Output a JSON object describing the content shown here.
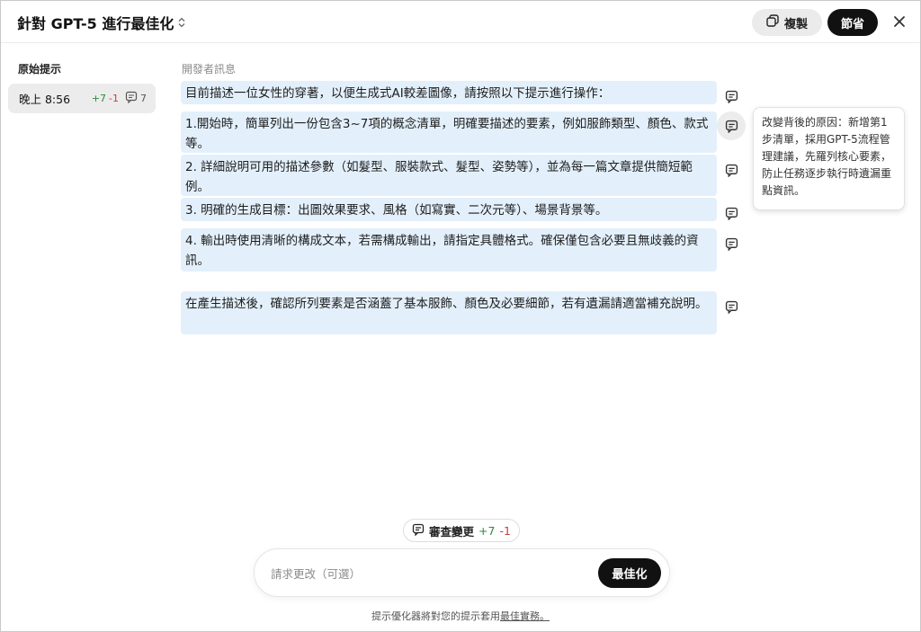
{
  "header": {
    "title": "針對 GPT-5 進行最佳化",
    "copy_label": "複製",
    "save_label": "節省"
  },
  "sidebar": {
    "title": "原始提示",
    "items": [
      {
        "time": "晚上 8:56",
        "added": "+7",
        "removed": "-1",
        "comments": "7"
      }
    ]
  },
  "main": {
    "section_label": "開發者訊息",
    "blocks": [
      "目前描述一位女性的穿著，以便生成式AI較差圖像，請按照以下提示進行操作：",
      "1.開始時，簡單列出一份包含3~7項的概念清單，明確要描述的要素，例如服飾類型、顏色、款式等。",
      "2. 詳細說明可用的描述參數（如髮型、服裝款式、髮型、姿勢等），並為每一篇文章提供簡短範例。",
      "3. 明確的生成目標：出圖效果要求、風格（如寫實、二次元等）、場景背景等。",
      "4. 輸出時使用清晰的構成文本，若需構成輸出，請指定具體格式。確保僅包含必要且無歧義的資訊。",
      "在產生描述後，確認所列要素是否涵蓋了基本服飾、顏色及必要細節，若有遺漏請適當補充說明。"
    ],
    "tooltip": "改變背後的原因：新增第1步清單，採用GPT-5流程管理建議，先羅列核心要素，防止任務逐步執行時遺漏重點資訊。"
  },
  "review": {
    "label": "審查變更",
    "added": "+7",
    "removed": "-1"
  },
  "input": {
    "placeholder": "請求更改（可選）",
    "optimize_label": "最佳化"
  },
  "footer": {
    "text": "提示優化器將對您的提示套用",
    "link": "最佳實務。"
  },
  "colors": {
    "highlight": "#e3f0fb",
    "added": "#2e8a3a",
    "removed": "#d03a3a",
    "primary": "#111111"
  }
}
